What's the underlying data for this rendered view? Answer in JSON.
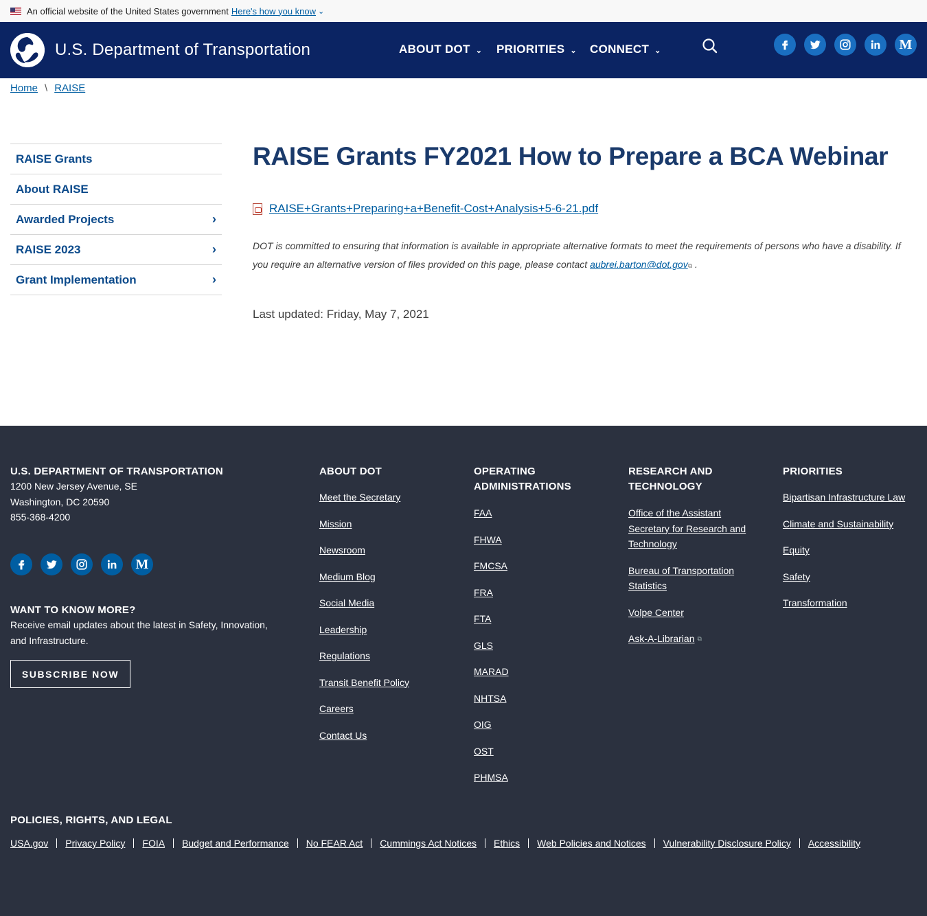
{
  "gov_banner": {
    "text": "An official website of the United States government",
    "link": "Here's how you know"
  },
  "header": {
    "site_title": "U.S. Department of Transportation",
    "nav": [
      "ABOUT DOT",
      "PRIORITIES",
      "CONNECT"
    ],
    "social": [
      "facebook-icon",
      "twitter-icon",
      "instagram-icon",
      "linkedin-icon",
      "medium-icon"
    ]
  },
  "breadcrumb": {
    "home": "Home",
    "separator": "\\",
    "current": "RAISE"
  },
  "sidenav": {
    "items": [
      {
        "label": "RAISE Grants",
        "has_children": false
      },
      {
        "label": "About RAISE",
        "has_children": false
      },
      {
        "label": "Awarded Projects",
        "has_children": true
      },
      {
        "label": "RAISE 2023",
        "has_children": true
      },
      {
        "label": "Grant Implementation",
        "has_children": true
      }
    ]
  },
  "main": {
    "title": "RAISE Grants FY2021 How to Prepare a BCA Webinar",
    "file_link": "RAISE+Grants+Preparing+a+Benefit-Cost+Analysis+5-6-21.pdf",
    "access_note": "DOT is committed to ensuring that information is available in appropriate alternative formats to meet the requirements of persons who have a disability. If you require an alternative version of files provided on this page, please contact",
    "contact_email": "aubrei.barton@dot.gov",
    "note_end": ".",
    "last_updated": "Last updated: Friday, May 7, 2021"
  },
  "footer": {
    "org": {
      "heading": "U.S. DEPARTMENT OF TRANSPORTATION",
      "address1": "1200 New Jersey Avenue, SE",
      "address2": "Washington, DC 20590",
      "phone": "855-368-4200"
    },
    "more": {
      "heading": "WANT TO KNOW MORE?",
      "text": "Receive email updates about the latest in Safety, Innovation, and Infrastructure.",
      "button": "SUBSCRIBE NOW"
    },
    "about": {
      "heading": "ABOUT DOT",
      "links": [
        "Meet the Secretary",
        "Mission",
        "Newsroom",
        "Medium Blog",
        "Social Media",
        "Leadership",
        "Regulations",
        "Transit Benefit Policy",
        "Careers",
        "Contact Us"
      ]
    },
    "operating": {
      "heading": "OPERATING ADMINISTRATIONS",
      "links": [
        "FAA",
        "FHWA",
        "FMCSA",
        "FRA",
        "FTA",
        "GLS",
        "MARAD",
        "NHTSA",
        "OIG",
        "OST",
        "PHMSA"
      ]
    },
    "research": {
      "heading": "RESEARCH AND TECHNOLOGY",
      "links": [
        "Office of the Assistant Secretary for Research and Technology",
        "Bureau of Transportation Statistics",
        "Volpe Center",
        "Ask-A-Librarian"
      ]
    },
    "priorities": {
      "heading": "PRIORITIES",
      "links": [
        "Bipartisan Infrastructure Law",
        "Climate and Sustainability",
        "Equity",
        "Safety",
        "Transformation"
      ]
    },
    "policies": {
      "heading": "POLICIES, RIGHTS, AND LEGAL",
      "links": [
        "USA.gov",
        "Privacy Policy",
        "FOIA",
        "Budget and Performance",
        "No FEAR Act",
        "Cummings Act Notices",
        "Ethics",
        "Web Policies and Notices",
        "Vulnerability Disclosure Policy",
        "Accessibility"
      ]
    }
  },
  "colors": {
    "header_bg": "#0b2463",
    "footer_bg": "#2b313f",
    "link": "#005ea2",
    "title": "#1a3a6b"
  }
}
